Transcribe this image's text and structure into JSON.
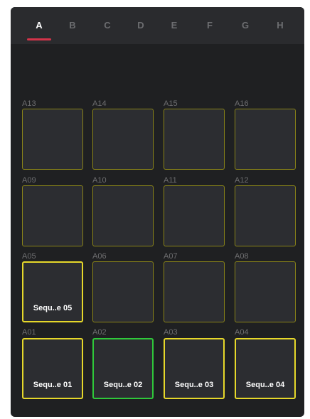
{
  "tabs": [
    {
      "label": "A",
      "active": true
    },
    {
      "label": "B",
      "active": false
    },
    {
      "label": "C",
      "active": false
    },
    {
      "label": "D",
      "active": false
    },
    {
      "label": "E",
      "active": false
    },
    {
      "label": "F",
      "active": false
    },
    {
      "label": "G",
      "active": false
    },
    {
      "label": "H",
      "active": false
    }
  ],
  "colors": {
    "accent_tab": "#d4344a",
    "pad_border_empty": "#8a8418",
    "pad_border_assigned": "#e6d82a",
    "pad_border_selected": "#2fc83a"
  },
  "pads": [
    {
      "id": "A13",
      "name": "",
      "state": "empty"
    },
    {
      "id": "A14",
      "name": "",
      "state": "empty"
    },
    {
      "id": "A15",
      "name": "",
      "state": "empty"
    },
    {
      "id": "A16",
      "name": "",
      "state": "empty"
    },
    {
      "id": "A09",
      "name": "",
      "state": "empty"
    },
    {
      "id": "A10",
      "name": "",
      "state": "empty"
    },
    {
      "id": "A11",
      "name": "",
      "state": "empty"
    },
    {
      "id": "A12",
      "name": "",
      "state": "empty"
    },
    {
      "id": "A05",
      "name": "Sequ..e 05",
      "state": "assigned"
    },
    {
      "id": "A06",
      "name": "",
      "state": "empty"
    },
    {
      "id": "A07",
      "name": "",
      "state": "empty"
    },
    {
      "id": "A08",
      "name": "",
      "state": "empty"
    },
    {
      "id": "A01",
      "name": "Sequ..e 01",
      "state": "assigned"
    },
    {
      "id": "A02",
      "name": "Sequ..e 02",
      "state": "selected"
    },
    {
      "id": "A03",
      "name": "Sequ..e 03",
      "state": "assigned"
    },
    {
      "id": "A04",
      "name": "Sequ..e 04",
      "state": "assigned"
    }
  ]
}
